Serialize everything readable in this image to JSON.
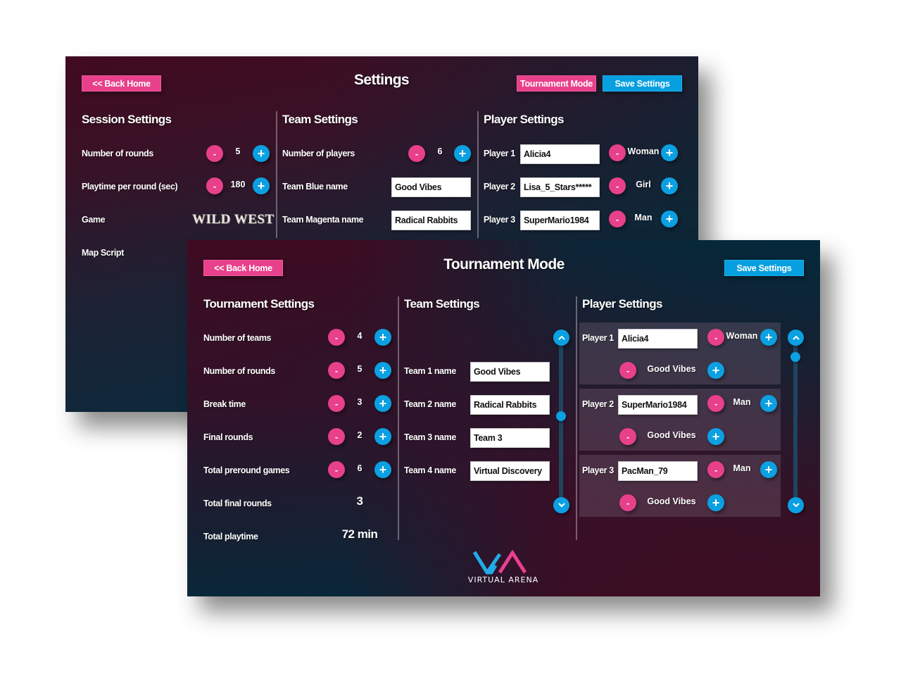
{
  "colors": {
    "accent_pink": "#e8408a",
    "accent_blue": "#0ba0e2",
    "bg_dark_red": "#420a20",
    "bg_dark_teal": "#042d40"
  },
  "settings_screen": {
    "title": "Settings",
    "back_home_label": "<< Back Home",
    "tournament_mode_label": "Tournament Mode",
    "save_settings_label": "Save Settings",
    "session": {
      "heading": "Session Settings",
      "rows": [
        {
          "label": "Number of rounds",
          "value": "5"
        },
        {
          "label": "Playtime per round (sec)",
          "value": "180"
        }
      ],
      "game_label": "Game",
      "game_value": "WILD WEST",
      "map_script_label": "Map Script"
    },
    "team": {
      "heading": "Team Settings",
      "players_label": "Number of players",
      "players_value": "6",
      "blue_label": "Team Blue name",
      "blue_value": "Good Vibes",
      "magenta_label": "Team Magenta name",
      "magenta_value": "Radical Rabbits"
    },
    "player": {
      "heading": "Player Settings",
      "players": [
        {
          "label": "Player 1",
          "name": "Alicia4",
          "type": "Woman"
        },
        {
          "label": "Player 2",
          "name": "Lisa_5_Stars*****",
          "type": "Girl"
        },
        {
          "label": "Player 3",
          "name": "SuperMario1984",
          "type": "Man"
        }
      ]
    }
  },
  "tournament_screen": {
    "title": "Tournament Mode",
    "back_home_label": "<< Back Home",
    "save_settings_label": "Save Settings",
    "tournament": {
      "heading": "Tournament Settings",
      "rows": [
        {
          "label": "Number of teams",
          "value": "4"
        },
        {
          "label": "Number of rounds",
          "value": "5"
        },
        {
          "label": "Break time",
          "value": "3"
        },
        {
          "label": "Final rounds",
          "value": "2"
        },
        {
          "label": "Total preround games",
          "value": "6"
        }
      ],
      "total_final_label": "Total final rounds",
      "total_final_value": "3",
      "total_playtime_label": "Total playtime",
      "total_playtime_value": "72 min"
    },
    "team": {
      "heading": "Team Settings",
      "teams": [
        {
          "label": "Team 1 name",
          "value": "Good Vibes"
        },
        {
          "label": "Team 2 name",
          "value": "Radical Rabbits"
        },
        {
          "label": "Team 3 name",
          "value": "Team 3"
        },
        {
          "label": "Team 4 name",
          "value": "Virtual Discovery"
        }
      ]
    },
    "player": {
      "heading": "Player Settings",
      "players": [
        {
          "label": "Player 1",
          "name": "Alicia4",
          "type": "Woman",
          "team": "Good Vibes"
        },
        {
          "label": "Player 2",
          "name": "SuperMario1984",
          "type": "Man",
          "team": "Good Vibes"
        },
        {
          "label": "Player 3",
          "name": "PacMan_79",
          "type": "Man",
          "team": "Good Vibes"
        }
      ]
    },
    "logo_text": "VIRTUAL ARENA"
  },
  "icons": {
    "minus": "-",
    "plus": "+"
  }
}
